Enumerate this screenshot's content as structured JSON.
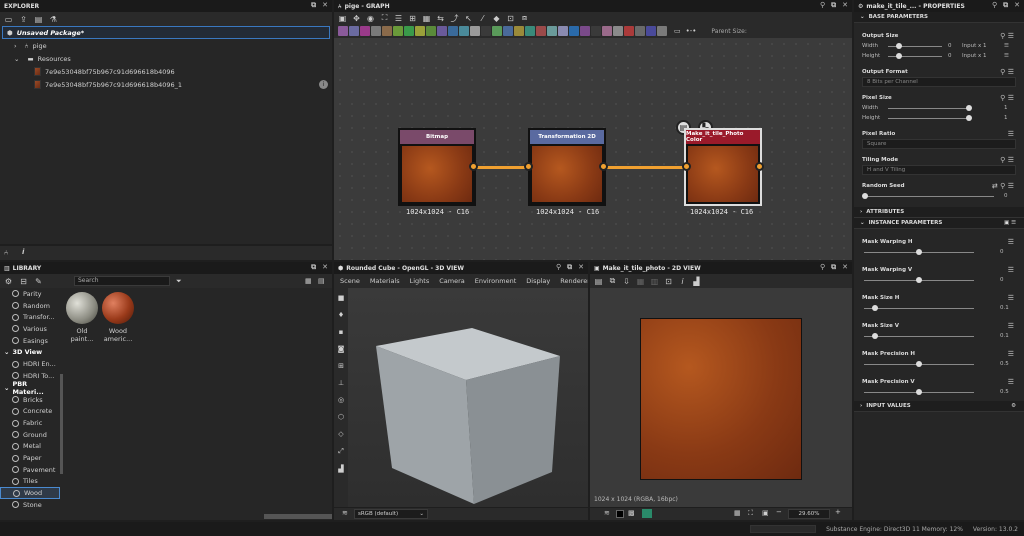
{
  "explorer": {
    "title": "EXPLORER",
    "package": "Unsaved Package*",
    "items": [
      {
        "label": "pige"
      },
      {
        "label": "Resources"
      },
      {
        "label": "7e9e53048bf75b967c91d696618b4096"
      },
      {
        "label": "7e9e53048bf75b967c91d696618b4096_1"
      }
    ]
  },
  "library": {
    "title": "LIBRARY",
    "search_placeholder": "Search",
    "items": [
      {
        "label": "Parity"
      },
      {
        "label": "Random"
      },
      {
        "label": "Transfor..."
      },
      {
        "label": "Various"
      },
      {
        "label": "Easings"
      }
    ],
    "section_3d": "3D View",
    "items_3d": [
      {
        "label": "HDRI En..."
      },
      {
        "label": "HDRI To..."
      }
    ],
    "section_pbr": "PBR Materi...",
    "items_pbr": [
      {
        "label": "Bricks"
      },
      {
        "label": "Concrete"
      },
      {
        "label": "Fabric"
      },
      {
        "label": "Ground"
      },
      {
        "label": "Metal"
      },
      {
        "label": "Paper"
      },
      {
        "label": "Pavement"
      },
      {
        "label": "Tiles"
      },
      {
        "label": "Wood"
      },
      {
        "label": "Stone"
      }
    ],
    "thumbs": [
      {
        "label": "Old paint..."
      },
      {
        "label": "Wood americ..."
      }
    ]
  },
  "graph": {
    "title": "pige - GRAPH",
    "parent_size_label": "Parent Size:",
    "nodes": [
      {
        "title": "Bitmap",
        "res": "1024x1024 - C16",
        "color": "#7a4a6a"
      },
      {
        "title": "Transformation 2D",
        "res": "1024x1024 - C16",
        "color": "#5a6aa0"
      },
      {
        "title": "Make_it_tile_Photo Color",
        "res": "1024x1024 - C16",
        "color": "#9a1a2a"
      }
    ]
  },
  "view3d": {
    "title": "Rounded Cube - OpenGL - 3D VIEW",
    "menu": [
      "Scene",
      "Materials",
      "Lights",
      "Camera",
      "Environment",
      "Display",
      "Renderer"
    ],
    "colorspace": "sRGB (default)"
  },
  "view2d": {
    "title": "Make_it_tile_photo - 2D VIEW",
    "info": "1024 x 1024 (RGBA, 16bpc)",
    "zoom": "29.60%"
  },
  "properties": {
    "title": "make_it_tile_... - PROPERTIES",
    "base_parameters": "BASE PARAMETERS",
    "output_size": "Output Size",
    "width": "Width",
    "height": "Height",
    "width_val": "0",
    "height_val": "0",
    "input_x1": "Input x 1",
    "output_format": "Output Format",
    "output_format_val": "8 Bits per Channel",
    "pixel_size": "Pixel Size",
    "ps_width": "Width",
    "ps_height": "Height",
    "ps_val": "1",
    "pixel_ratio": "Pixel Ratio",
    "pixel_ratio_val": "Square",
    "tiling_mode": "Tiling Mode",
    "tiling_mode_val": "H and V Tiling",
    "random_seed": "Random Seed",
    "random_seed_val": "0",
    "attributes": "ATTRIBUTES",
    "instance_parameters": "INSTANCE PARAMETERS",
    "params": [
      {
        "label": "Mask Warping H",
        "value": "0",
        "level": 0.5
      },
      {
        "label": "Mask Warping V",
        "value": "0",
        "level": 0.5
      },
      {
        "label": "Mask Size H",
        "value": "0.1",
        "level": 0.1
      },
      {
        "label": "Mask Size V",
        "value": "0.1",
        "level": 0.1
      },
      {
        "label": "Mask Precision H",
        "value": "0.5",
        "level": 0.5
      },
      {
        "label": "Mask Precision V",
        "value": "0.5",
        "level": 0.5
      }
    ],
    "input_values": "INPUT VALUES"
  },
  "status": {
    "engine": "Substance Engine: Direct3D 11 Memory: 12%",
    "version": "Version: 13.0.2"
  }
}
